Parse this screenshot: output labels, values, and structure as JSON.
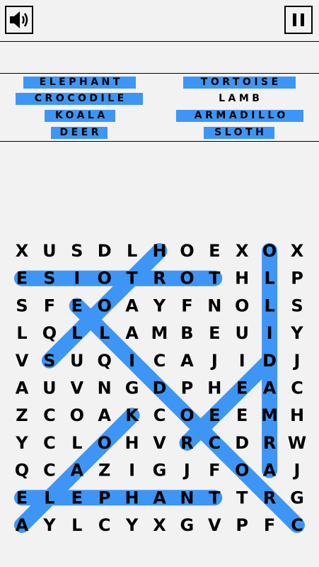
{
  "colors": {
    "highlight": "#3d96f5",
    "background": "#f2f2f2"
  },
  "toolbar": {
    "sound_icon": "speaker-icon",
    "pause_icon": "pause-icon"
  },
  "words": [
    {
      "label": "ELEPHANT",
      "found": true
    },
    {
      "label": "TORTOISE",
      "found": true
    },
    {
      "label": "CROCODILE",
      "found": true
    },
    {
      "label": "LAMB",
      "found": false
    },
    {
      "label": "KOALA",
      "found": true
    },
    {
      "label": "ARMADILLO",
      "found": true
    },
    {
      "label": "DEER",
      "found": true
    },
    {
      "label": "SLOTH",
      "found": true
    }
  ],
  "grid": [
    "XUSDLHOEXOX",
    "ESIOTROTHLP",
    "SFEOAYFNOLS",
    "LQLLAMBEUIY",
    "VSUQICAJIDJ",
    "AUVNGDPHEAC",
    "ZCOAKCOEEMH",
    "YCLOHVRCDRW",
    "QCAZIGJFOAJ",
    "ELEPHANTTRG",
    "AYLCYXGVPFC"
  ],
  "found_paths": [
    {
      "word": "TORTOISE",
      "from": [
        1,
        7
      ],
      "to": [
        1,
        0
      ]
    },
    {
      "word": "ELEPHANT",
      "from": [
        9,
        0
      ],
      "to": [
        9,
        7
      ]
    },
    {
      "word": "ARMADILLO",
      "from": [
        8,
        9
      ],
      "to": [
        0,
        9
      ]
    },
    {
      "word": "SLOTH",
      "from": [
        4,
        1
      ],
      "to": [
        0,
        5
      ]
    },
    {
      "word": "KOALA",
      "from": [
        6,
        4
      ],
      "to": [
        10,
        0
      ]
    },
    {
      "word": "DEER",
      "from": [
        4,
        9
      ],
      "to": [
        7,
        6
      ]
    },
    {
      "word": "CROCODILE",
      "from": [
        10,
        10
      ],
      "to": [
        2,
        2
      ]
    }
  ]
}
